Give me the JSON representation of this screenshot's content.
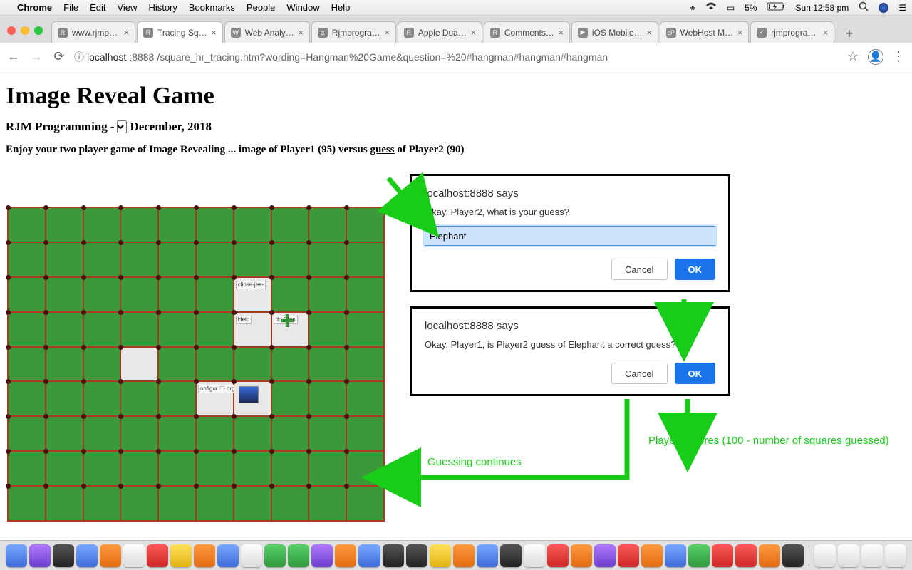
{
  "mac": {
    "app": "Chrome",
    "menus": [
      "File",
      "Edit",
      "View",
      "History",
      "Bookmarks",
      "People",
      "Window",
      "Help"
    ],
    "battery": "5%",
    "clock": "Sun 12:58 pm"
  },
  "tabs": [
    {
      "label": "www.rjmp…",
      "fav": "R"
    },
    {
      "label": "Tracing Sq…",
      "fav": "R",
      "active": true
    },
    {
      "label": "Web Analy…",
      "fav": "W"
    },
    {
      "label": "Rjmprogra…",
      "fav": "a"
    },
    {
      "label": "Apple Dua…",
      "fav": "R"
    },
    {
      "label": "Comments…",
      "fav": "R"
    },
    {
      "label": "iOS Mobile…",
      "fav": "▶"
    },
    {
      "label": "WebHost M…",
      "fav": "cP"
    },
    {
      "label": "rjmprogra…",
      "fav": "✓"
    }
  ],
  "address": {
    "scheme_icon": "ⓘ",
    "host": "localhost",
    "port": ":8888",
    "path": "/square_hr_tracing.htm?wording=Hangman%20Game&question=%20#hangman#hangman#hangman"
  },
  "page": {
    "title": "Image Reveal Game",
    "byline_pre": "RJM Programming",
    "byline_sep": "-",
    "byline_post": "December, 2018",
    "instr_pre": "Enjoy your two player game of Image Revealing ... image of Player1 (95) versus ",
    "instr_u": "guess",
    "instr_post": " of Player2 (90)"
  },
  "revealed_cells": [
    {
      "r": 2,
      "c": 6,
      "text": "clipse-jee-"
    },
    {
      "r": 3,
      "c": 6,
      "text": "Help"
    },
    {
      "r": 3,
      "c": 7,
      "plus": true,
      "text": "dd Files"
    },
    {
      "r": 4,
      "c": 3
    },
    {
      "r": 5,
      "c": 5,
      "text": "onfigur\n🗀 org"
    },
    {
      "r": 5,
      "c": 6,
      "img": true
    }
  ],
  "dialog1": {
    "host": "localhost:8888 says",
    "msg": "Okay, Player2, what is your guess?",
    "value": "Elephant",
    "cancel": "Cancel",
    "ok": "OK"
  },
  "dialog2": {
    "host": "localhost:8888 says",
    "msg": "Okay, Player1, is Player2 guess of Elephant a correct guess?",
    "cancel": "Cancel",
    "ok": "OK"
  },
  "annotations": {
    "score": "Player2 scores (100 - number of squares guessed)",
    "cont": "Guessing continues"
  }
}
